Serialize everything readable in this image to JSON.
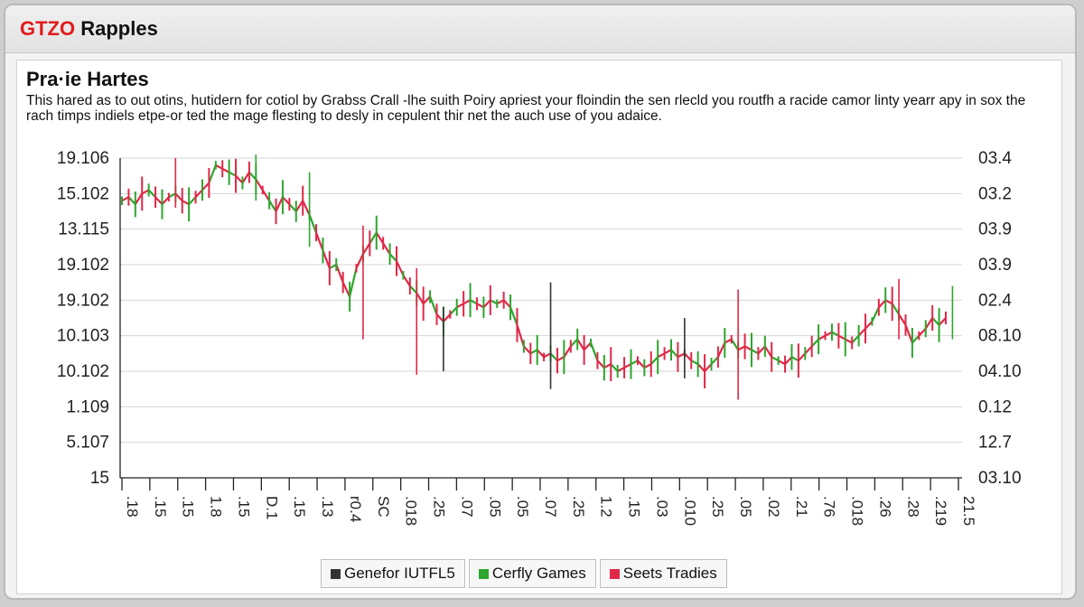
{
  "window": {
    "title_brand": "GTZO",
    "title_rest": " Rapples"
  },
  "chart_data": {
    "type": "line",
    "title": "Pra·ie Hartes",
    "subtitle": "This hared as to out otins, hutidern for cotiol by Grabss Crall -lhe suith Poiry apriest your floindin the sen rlecld you routfh a racide camor linty yearr apy in sox the rach timps indiels etpe-or ted the mage flesting to desly in cepulent thir net the auch use of you adaice.",
    "y_left_ticks": [
      "19.106",
      "15.102",
      "13.115",
      "19.102",
      "19.102",
      "10.103",
      "10.102",
      "1.109",
      "5.107",
      "15"
    ],
    "y_right_ticks": [
      "03.4",
      "03.2",
      "03.9",
      "03.9",
      "02.4",
      "08.10",
      "04.10",
      "0.12",
      "12.7",
      "03.10"
    ],
    "x_ticks": [
      ".18",
      ".15",
      ".15",
      "1.8",
      ".15",
      "D.1",
      ".15",
      ".13",
      "r0.4",
      "SC",
      ".018",
      ".25",
      ".07",
      ".05",
      ".05",
      ".07",
      ".25",
      "1.2",
      ".15",
      ".03",
      ".010",
      ".25",
      ".05",
      ".02",
      ".21",
      ".76",
      ".018",
      ".26",
      ".28",
      ".219",
      "21.5"
    ],
    "ylim": [
      0,
      9
    ],
    "grid": true,
    "legend_position": "bottom-center",
    "series": [
      {
        "name": "Genefor IUTFL5",
        "color": "#333333"
      },
      {
        "name": "Cerfly Games",
        "color": "#2ea52e"
      },
      {
        "name": "Seets Tradies",
        "color": "#e02848"
      }
    ],
    "values": [
      7.8,
      7.9,
      7.7,
      8.0,
      8.1,
      7.9,
      7.7,
      7.9,
      8.0,
      7.8,
      7.7,
      7.9,
      8.1,
      8.3,
      8.8,
      8.7,
      8.6,
      8.5,
      8.3,
      8.6,
      8.4,
      8.1,
      7.8,
      7.5,
      7.9,
      7.7,
      7.5,
      7.8,
      7.4,
      6.9,
      6.4,
      5.9,
      6.0,
      5.5,
      5.1,
      5.9,
      6.3,
      6.6,
      6.9,
      6.6,
      6.3,
      6.1,
      5.7,
      5.4,
      5.2,
      4.9,
      5.1,
      4.6,
      4.4,
      4.6,
      4.8,
      4.9,
      5.0,
      4.9,
      4.8,
      5.0,
      4.9,
      5.0,
      4.8,
      4.3,
      3.7,
      3.5,
      3.6,
      3.4,
      3.5,
      3.3,
      3.4,
      3.7,
      3.9,
      3.6,
      3.8,
      3.3,
      3.1,
      3.2,
      3.0,
      3.1,
      3.2,
      3.3,
      3.1,
      3.2,
      3.4,
      3.5,
      3.6,
      3.4,
      3.5,
      3.3,
      3.2,
      3.0,
      3.2,
      3.4,
      3.8,
      3.9,
      3.6,
      3.7,
      3.6,
      3.5,
      3.7,
      3.4,
      3.3,
      3.2,
      3.4,
      3.3,
      3.5,
      3.7,
      3.9,
      4.0,
      4.1,
      4.0,
      3.9,
      3.8,
      4.0,
      4.2,
      4.4,
      4.8,
      5.0,
      4.9,
      4.6,
      4.3,
      3.8,
      4.0,
      4.2,
      4.5,
      4.3,
      4.5
    ],
    "spikes": [
      {
        "i": 48,
        "hi": 4.8,
        "lo": 3.0,
        "c": 0
      },
      {
        "i": 64,
        "hi": 5.5,
        "lo": 2.5,
        "c": 0
      },
      {
        "i": 84,
        "hi": 4.5,
        "lo": 2.8,
        "c": 0
      },
      {
        "i": 92,
        "hi": 5.3,
        "lo": 2.2,
        "c": 2
      },
      {
        "i": 8,
        "hi": 9.0,
        "lo": 7.6,
        "c": 2
      },
      {
        "i": 20,
        "hi": 9.1,
        "lo": 7.8,
        "c": 1
      },
      {
        "i": 28,
        "hi": 8.6,
        "lo": 6.5,
        "c": 1
      },
      {
        "i": 36,
        "hi": 7.1,
        "lo": 3.9,
        "c": 2
      },
      {
        "i": 44,
        "hi": 5.9,
        "lo": 2.9,
        "c": 2
      },
      {
        "i": 116,
        "hi": 5.6,
        "lo": 3.9,
        "c": 2
      },
      {
        "i": 124,
        "hi": 5.4,
        "lo": 3.9,
        "c": 1
      }
    ]
  }
}
